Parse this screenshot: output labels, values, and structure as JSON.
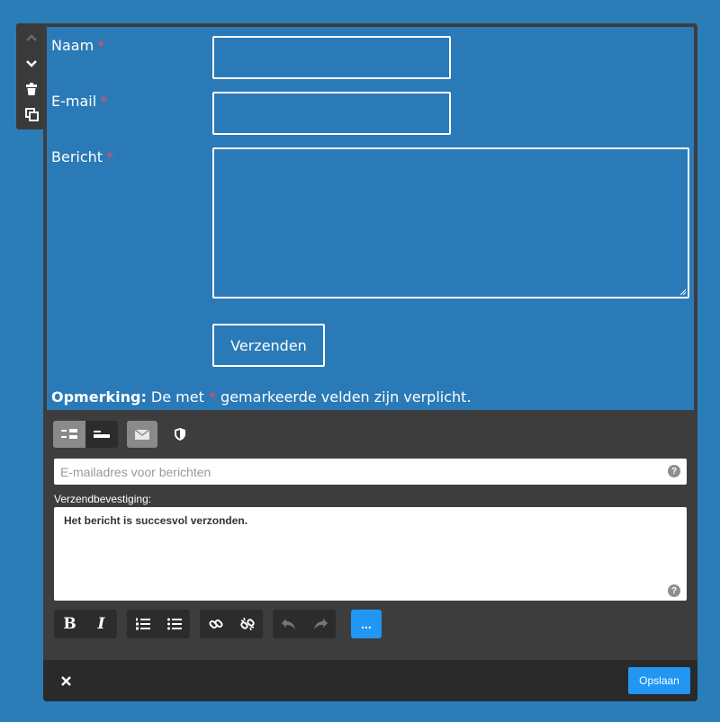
{
  "form": {
    "fields": [
      {
        "label": "Naam",
        "required_mark": "*"
      },
      {
        "label": "E-mail",
        "required_mark": "*"
      },
      {
        "label": "Bericht",
        "required_mark": "*"
      }
    ],
    "submit_label": "Verzenden",
    "note_strong": "Opmerking:",
    "note_before": " De met ",
    "note_mark": "*",
    "note_after": " gemarkeerde velden zijn verplicht."
  },
  "settings": {
    "email_placeholder": "E-mailadres voor berichten",
    "confirm_label": "Verzendbevestiging:",
    "confirm_text": "Het bericht is succesvol verzonden.",
    "help_glyph": "?"
  },
  "toolbar": {
    "bold_glyph": "B",
    "italic_glyph": "I",
    "more_label": "..."
  },
  "footer": {
    "close_glyph": "✕",
    "save_label": "Opslaan"
  },
  "colors": {
    "background": "#2b7db8",
    "panel": "#3d3d3d",
    "required": "#e8505b",
    "accent": "#2196f3"
  }
}
